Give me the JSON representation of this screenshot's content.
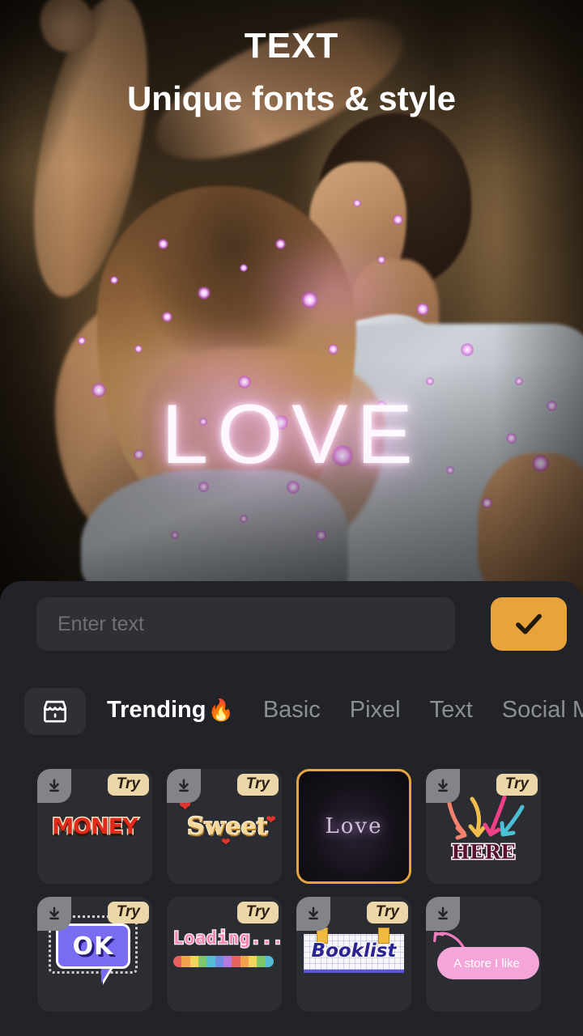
{
  "header": {
    "title": "TEXT",
    "subtitle": "Unique fonts & style"
  },
  "preview": {
    "overlay_word": "LOVE"
  },
  "input": {
    "placeholder": "Enter text",
    "value": "",
    "confirm_icon": "check-icon"
  },
  "tabbar": {
    "store_icon": "store-icon",
    "tabs": [
      {
        "label": "Trending",
        "emoji": "🔥",
        "active": true
      },
      {
        "label": "Basic",
        "emoji": "",
        "active": false
      },
      {
        "label": "Pixel",
        "emoji": "",
        "active": false
      },
      {
        "label": "Text",
        "emoji": "",
        "active": false
      },
      {
        "label": "Social M",
        "emoji": "",
        "active": false
      }
    ]
  },
  "stickers": {
    "try_label": "Try",
    "download_icon": "download-icon",
    "items": [
      {
        "name": "money",
        "text": "MONEY",
        "try": true,
        "download": true,
        "selected": false
      },
      {
        "name": "sweet",
        "text": "Sweet",
        "try": true,
        "download": true,
        "selected": false
      },
      {
        "name": "love",
        "text": "Love",
        "try": false,
        "download": false,
        "selected": true
      },
      {
        "name": "here",
        "text": "HERE",
        "try": true,
        "download": true,
        "selected": false
      },
      {
        "name": "ok",
        "text": "OK",
        "try": true,
        "download": true,
        "selected": false
      },
      {
        "name": "loading",
        "text": "Loading...",
        "try": true,
        "download": false,
        "selected": false
      },
      {
        "name": "booklist",
        "text": "Booklist",
        "try": true,
        "download": true,
        "selected": false
      },
      {
        "name": "store",
        "text": "A store I like",
        "try": false,
        "download": true,
        "selected": false
      }
    ]
  },
  "colors": {
    "accent": "#e9a33c",
    "panel_bg": "#222328",
    "card_bg": "#2b2d32",
    "try_badge_bg": "#ecd7a9",
    "selected_border": "#e3a53f",
    "tab_inactive": "#8b8e94"
  }
}
